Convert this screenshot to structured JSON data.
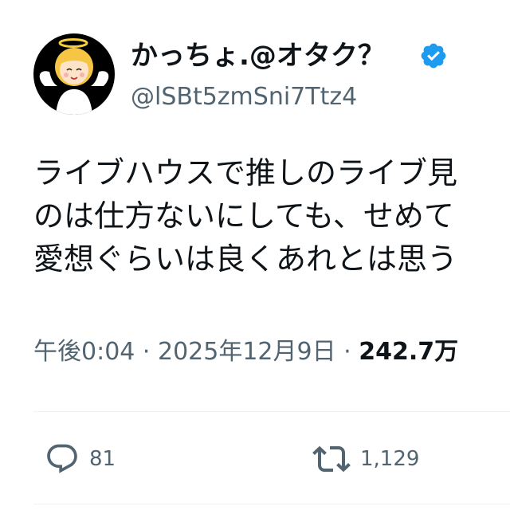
{
  "author": {
    "display_name": "かっちょ.@オタク？",
    "handle": "@lSBt5zmSni7Ttz4",
    "verified": true,
    "avatar_icon": "angel-avatar-icon"
  },
  "tweet": {
    "lines": [
      "ライブハウスで推しのライブ見",
      "のは仕方ないにしても、せめて",
      "愛想ぐらいは良くあれとは思う"
    ]
  },
  "meta": {
    "time": "午後0:04",
    "separator1": " · ",
    "date": "2025年12月9日",
    "separator2": " · ",
    "views": "242.7万"
  },
  "actions": {
    "reply_count": "81",
    "retweet_count": "1,129"
  },
  "colors": {
    "text_primary": "#0f1419",
    "text_secondary": "#536471",
    "verified_blue": "#1d9bf0",
    "divider": "#eff3f4"
  }
}
